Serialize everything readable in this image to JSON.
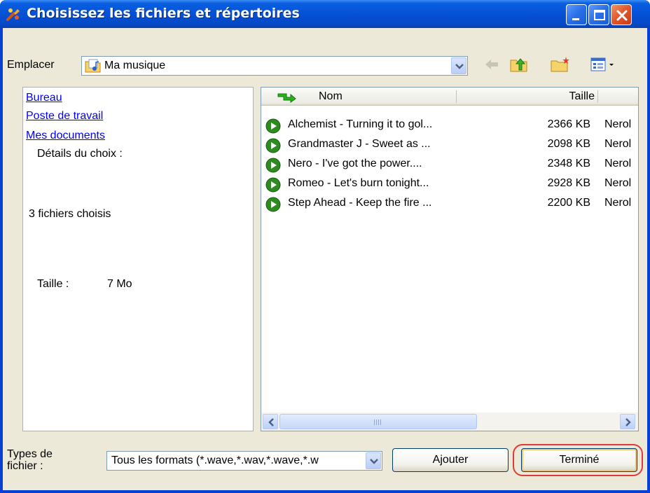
{
  "window": {
    "title": "Choisissez les fichiers et répertoires"
  },
  "location": {
    "label": "Emplacer",
    "value": "Ma musique"
  },
  "places": {
    "bureau": "Bureau",
    "poste": "Poste de travail",
    "documents": "Mes documents"
  },
  "details": {
    "heading": "Détails du choix :",
    "count_text": "3 fichiers choisis",
    "size_label": "Taille :",
    "size_value": "7 Mo"
  },
  "file_list": {
    "columns": {
      "name": "Nom",
      "size": "Taille"
    },
    "rows": [
      {
        "name": "Alchemist - Turning it to gol...",
        "size": "2366 KB",
        "type": "Nerol"
      },
      {
        "name": "Grandmaster J - Sweet as ...",
        "size": "2098 KB",
        "type": "Nerol"
      },
      {
        "name": "Nero -  I've got the power....",
        "size": "2348 KB",
        "type": "Nerol"
      },
      {
        "name": "Romeo -  Let's burn tonight...",
        "size": "2928 KB",
        "type": "Nerol"
      },
      {
        "name": "Step Ahead - Keep the fire ...",
        "size": "2200 KB",
        "type": "Nerol"
      }
    ]
  },
  "filetype": {
    "label_line1": "Types de",
    "label_line2": "fichier :",
    "value": "Tous les formats  (*.wave,*.wav,*.wave,*.w"
  },
  "buttons": {
    "add": "Ajouter",
    "done": "Terminé"
  },
  "colors": {
    "titlebar": "#0551d6",
    "link": "#0000ff",
    "highlight": "#e03a3a",
    "dialog_bg": "#ece9d8"
  },
  "icons": {
    "app": "wrench-app-icon",
    "back": "back-arrow-icon",
    "up": "folder-up-icon",
    "new_folder": "new-folder-icon",
    "view": "view-menu-icon",
    "file": "play-circle-icon",
    "sort": "sort-arrow-icon"
  }
}
